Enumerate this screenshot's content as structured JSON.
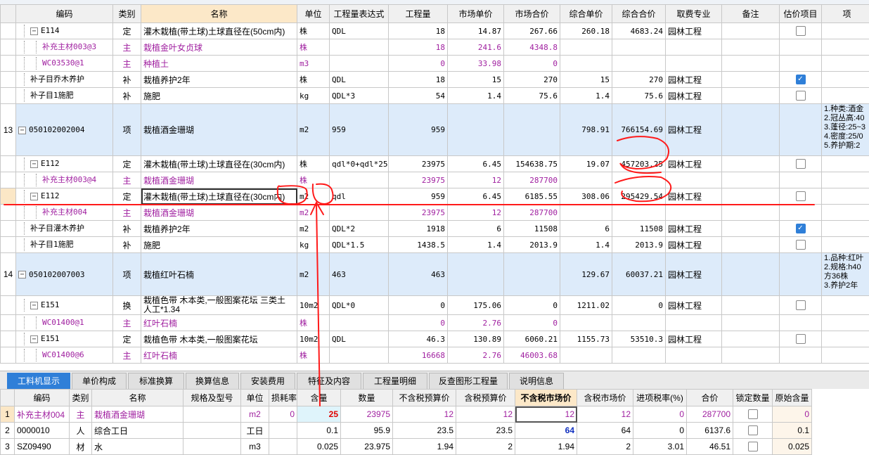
{
  "headers": [
    "编码",
    "类别",
    "名称",
    "单位",
    "工程量表达式",
    "工程量",
    "市场单价",
    "市场合价",
    "综合单价",
    "综合合价",
    "取费专业",
    "备注",
    "估价项目",
    "项"
  ],
  "rows": [
    {
      "no": "",
      "code": "E114",
      "cat": "定",
      "name": "灌木栽植(带土球)土球直径在(50cm内)",
      "unit": "株",
      "expr": "QDL",
      "qty": "18",
      "mprice": "14.87",
      "mtotal": "267.66",
      "cprice": "260.18",
      "ctotal": "4683.24",
      "major": "园林工程",
      "cb": "off"
    },
    {
      "no": "",
      "code": "补充主材003@3",
      "cat": "主",
      "name": "栽植金叶女贞球",
      "unit": "株",
      "expr": "",
      "qty": "18",
      "mprice": "241.6",
      "mtotal": "4348.8",
      "cprice": "",
      "ctotal": "",
      "major": "",
      "cb": ""
    },
    {
      "no": "",
      "code": "WC03530@1",
      "cat": "主",
      "name": "种植土",
      "unit": "m3",
      "expr": "",
      "qty": "0",
      "mprice": "33.98",
      "mtotal": "0",
      "cprice": "",
      "ctotal": "",
      "major": "",
      "cb": ""
    },
    {
      "no": "",
      "code": "补子目乔木养护",
      "cat": "补",
      "name": "栽植养护2年",
      "unit": "株",
      "expr": "QDL",
      "qty": "18",
      "mprice": "15",
      "mtotal": "270",
      "cprice": "15",
      "ctotal": "270",
      "major": "园林工程",
      "cb": "on"
    },
    {
      "no": "",
      "code": "补子目1施肥",
      "cat": "补",
      "name": "施肥",
      "unit": "kg",
      "expr": "QDL*3",
      "qty": "54",
      "mprice": "1.4",
      "mtotal": "75.6",
      "cprice": "1.4",
      "ctotal": "75.6",
      "major": "园林工程",
      "cb": "off"
    },
    {
      "no": "13",
      "code": "050102002004",
      "cat": "项",
      "name": "栽植酒金珊瑚",
      "unit": "m2",
      "expr": "959",
      "qty": "959",
      "mprice": "",
      "mtotal": "",
      "cprice": "798.91",
      "ctotal": "766154.69",
      "major": "园林工程",
      "cb": "",
      "note": [
        "1.种类:酒金",
        "2.冠丛高:40",
        "3.蓬径:25~3",
        "4.密度:25/0",
        "5.养护期:2"
      ]
    },
    {
      "no": "",
      "code": "E112",
      "cat": "定",
      "name": "灌木栽植(带土球)土球直径在(30cm内)",
      "unit": "株",
      "expr": "qdl*0+qdl*25",
      "qty": "23975",
      "mprice": "6.45",
      "mtotal": "154638.75",
      "cprice": "19.07",
      "ctotal": "457203.25",
      "major": "园林工程",
      "cb": "off"
    },
    {
      "no": "",
      "code": "补充主材003@4",
      "cat": "主",
      "name": "栽植酒金珊瑚",
      "unit": "株",
      "expr": "",
      "qty": "23975",
      "mprice": "12",
      "mtotal": "287700",
      "cprice": "",
      "ctotal": "",
      "major": "",
      "cb": ""
    },
    {
      "no": "",
      "code": "E112",
      "cat": "定",
      "name": "灌木栽植(带土球)土球直径在(30cm内)",
      "unit": "m2",
      "expr": "qdl",
      "qty": "959",
      "mprice": "6.45",
      "mtotal": "6185.55",
      "cprice": "308.06",
      "ctotal": "295429.54",
      "major": "园林工程",
      "cb": "off"
    },
    {
      "no": "",
      "code": "补充主材004",
      "cat": "主",
      "name": "栽植酒金珊瑚",
      "unit": "m2",
      "expr": "",
      "qty": "23975",
      "mprice": "12",
      "mtotal": "287700",
      "cprice": "",
      "ctotal": "",
      "major": "",
      "cb": ""
    },
    {
      "no": "",
      "code": "补子目灌木养护",
      "cat": "补",
      "name": "栽植养护2年",
      "unit": "m2",
      "expr": "QDL*2",
      "qty": "1918",
      "mprice": "6",
      "mtotal": "11508",
      "cprice": "6",
      "ctotal": "11508",
      "major": "园林工程",
      "cb": "on"
    },
    {
      "no": "",
      "code": "补子目1施肥",
      "cat": "补",
      "name": "施肥",
      "unit": "kg",
      "expr": "QDL*1.5",
      "qty": "1438.5",
      "mprice": "1.4",
      "mtotal": "2013.9",
      "cprice": "1.4",
      "ctotal": "2013.9",
      "major": "园林工程",
      "cb": "off"
    },
    {
      "no": "14",
      "code": "050102007003",
      "cat": "项",
      "name": "栽植红叶石楠",
      "unit": "m2",
      "expr": "463",
      "qty": "463",
      "mprice": "",
      "mtotal": "",
      "cprice": "129.67",
      "ctotal": "60037.21",
      "major": "园林工程",
      "cb": "",
      "note": [
        "1.品种:红叶",
        "2.规格:h40",
        "方36株",
        "3.养护2年"
      ]
    },
    {
      "no": "",
      "code": "E151",
      "cat": "换",
      "name": "栽植色带 木本类,一般图案花坛 三类土 人工*1.34",
      "unit": "10m2",
      "expr": "QDL*0",
      "qty": "0",
      "mprice": "175.06",
      "mtotal": "0",
      "cprice": "1211.02",
      "ctotal": "0",
      "major": "园林工程",
      "cb": "off"
    },
    {
      "no": "",
      "code": "WC01400@1",
      "cat": "主",
      "name": "红叶石楠",
      "unit": "株",
      "expr": "",
      "qty": "0",
      "mprice": "2.76",
      "mtotal": "0",
      "cprice": "",
      "ctotal": "",
      "major": "",
      "cb": ""
    },
    {
      "no": "",
      "code": "E151",
      "cat": "定",
      "name": "栽植色带 木本类,一般图案花坛",
      "unit": "10m2",
      "expr": "QDL",
      "qty": "46.3",
      "mprice": "130.89",
      "mtotal": "6060.21",
      "cprice": "1155.73",
      "ctotal": "53510.3",
      "major": "园林工程",
      "cb": "off"
    },
    {
      "no": "",
      "code": "WC01400@6",
      "cat": "主",
      "name": "红叶石楠",
      "unit": "株",
      "expr": "",
      "qty": "16668",
      "mprice": "2.76",
      "mtotal": "46003.68",
      "cprice": "",
      "ctotal": "",
      "major": "",
      "cb": ""
    }
  ],
  "tabs": [
    "工料机显示",
    "单价构成",
    "标准换算",
    "换算信息",
    "安装费用",
    "特征及内容",
    "工程量明细",
    "反查图形工程量",
    "说明信息"
  ],
  "bottom_headers": [
    "编码",
    "类别",
    "名称",
    "规格及型号",
    "单位",
    "损耗率",
    "含量",
    "数量",
    "不含税预算价",
    "含税预算价",
    "不含税市场价",
    "含税市场价",
    "进项税率(%)",
    "合价",
    "锁定数量",
    "原始含量"
  ],
  "bottom_rows": [
    {
      "no": "1",
      "code": "补充主材004",
      "cat": "主",
      "name": "栽植酒金珊瑚",
      "spec": "",
      "unit": "m2",
      "loss": "0",
      "content": "25",
      "qty": "23975",
      "p1": "12",
      "p2": "12",
      "p3": "12",
      "p4": "12",
      "tax": "0",
      "total": "287700",
      "orig": "0"
    },
    {
      "no": "2",
      "code": "0000010",
      "cat": "人",
      "name": "综合工日",
      "spec": "",
      "unit": "工日",
      "loss": "",
      "content": "0.1",
      "qty": "95.9",
      "p1": "23.5",
      "p2": "23.5",
      "p3": "64",
      "p4": "64",
      "tax": "0",
      "total": "6137.6",
      "orig": "0.1"
    },
    {
      "no": "3",
      "code": "SZ09490",
      "cat": "材",
      "name": "水",
      "spec": "",
      "unit": "m3",
      "loss": "",
      "content": "0.025",
      "qty": "23.975",
      "p1": "1.94",
      "p2": "2",
      "p3": "1.94",
      "p4": "2",
      "tax": "3.01",
      "total": "46.51",
      "orig": "0.025"
    }
  ],
  "colors": {
    "accent": "#2f7fd8",
    "material_text": "#a020a0",
    "item_row_bg": "#ddebfa",
    "annotation": "#ff0000"
  }
}
